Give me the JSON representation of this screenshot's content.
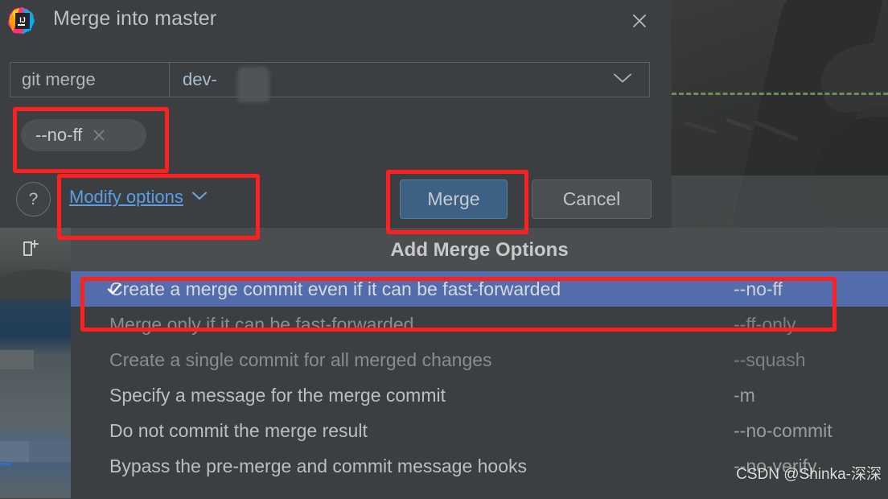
{
  "window": {
    "title": "Merge into master",
    "app_icon": "intellij-idea-icon",
    "close_icon": "close-icon"
  },
  "command": {
    "prefix": "git merge",
    "branch_value": "dev-",
    "branch_redacted": true,
    "dropdown_icon": "chevron-down-icon"
  },
  "chip": {
    "label": "--no-ff",
    "remove_icon": "close-icon"
  },
  "footer": {
    "help_icon": "question-mark-icon",
    "modify_options_label": "Modify options",
    "modify_options_icon": "chevron-down-icon",
    "merge_label": "Merge",
    "cancel_label": "Cancel"
  },
  "popup": {
    "header": "Add Merge Options",
    "items": [
      {
        "label": "Create a merge commit even if it can be fast-forwarded",
        "shortcut": "--no-ff",
        "selected": true,
        "checked": true,
        "dimmed": false
      },
      {
        "label": "Merge only if it can be fast-forwarded",
        "shortcut": "--ff-only",
        "selected": false,
        "checked": false,
        "dimmed": true
      },
      {
        "label": "Create a single commit for all merged changes",
        "shortcut": "--squash",
        "selected": false,
        "checked": false,
        "dimmed": true
      },
      {
        "label": "Specify a message for the merge commit",
        "shortcut": "-m",
        "selected": false,
        "checked": false,
        "dimmed": false
      },
      {
        "label": "Do not commit the merge result",
        "shortcut": "--no-commit",
        "selected": false,
        "checked": false,
        "dimmed": false
      },
      {
        "label": "Bypass the pre-merge and commit message hooks",
        "shortcut": "--no-verify",
        "selected": false,
        "checked": false,
        "dimmed": false
      }
    ]
  },
  "background": {
    "new_tab_icon": "new-tab-icon"
  },
  "watermark": "CSDN @Shinka-深深",
  "colors": {
    "dialog_bg": "#3c3f41",
    "accent_blue": "#3d6185",
    "selection_blue": "#536dac",
    "link_blue": "#5b9ee8",
    "highlight_red": "#fc2020",
    "text_primary": "#bcbfc1",
    "text_dim": "#8a8d8f"
  }
}
